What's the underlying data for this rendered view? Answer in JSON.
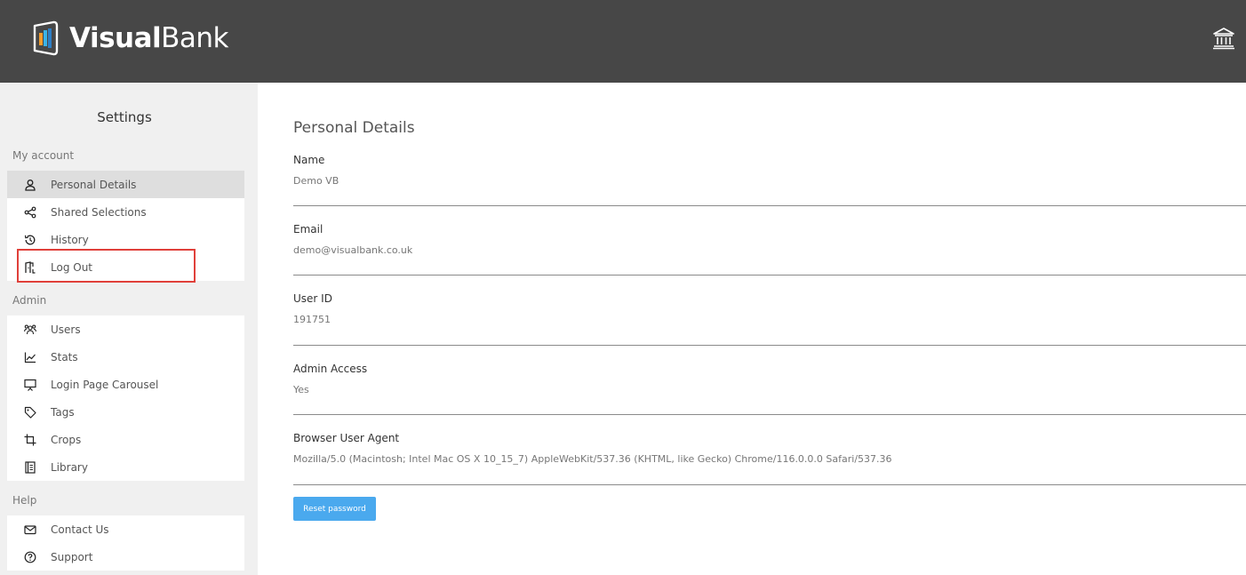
{
  "header": {
    "logo_bold": "Visual",
    "logo_light": "Bank",
    "bank_icon": "bank-icon"
  },
  "sidebar": {
    "title": "Settings",
    "sections": [
      {
        "label": "My account",
        "items": [
          {
            "label": "Personal Details",
            "icon": "user-icon",
            "active": true
          },
          {
            "label": "Shared Selections",
            "icon": "share-icon"
          },
          {
            "label": "History",
            "icon": "history-icon"
          },
          {
            "label": "Log Out",
            "icon": "logout-icon"
          }
        ]
      },
      {
        "label": "Admin",
        "items": [
          {
            "label": "Users",
            "icon": "users-icon"
          },
          {
            "label": "Stats",
            "icon": "chart-icon"
          },
          {
            "label": "Login Page Carousel",
            "icon": "presentation-icon"
          },
          {
            "label": "Tags",
            "icon": "tag-icon"
          },
          {
            "label": "Crops",
            "icon": "crop-icon"
          },
          {
            "label": "Library",
            "icon": "book-icon"
          }
        ]
      },
      {
        "label": "Help",
        "items": [
          {
            "label": "Contact Us",
            "icon": "mail-icon"
          },
          {
            "label": "Support",
            "icon": "help-circle-icon"
          }
        ]
      }
    ]
  },
  "main": {
    "title": "Personal Details",
    "fields": [
      {
        "label": "Name",
        "value": "Demo VB"
      },
      {
        "label": "Email",
        "value": "demo@visualbank.co.uk"
      },
      {
        "label": "User ID",
        "value": "191751"
      },
      {
        "label": "Admin Access",
        "value": "Yes"
      },
      {
        "label": "Browser User Agent",
        "value": "Mozilla/5.0 (Macintosh; Intel Mac OS X 10_15_7) AppleWebKit/537.36 (KHTML, like Gecko) Chrome/116.0.0.0 Safari/537.36"
      }
    ],
    "reset_button": "Reset password"
  },
  "colors": {
    "header_bg": "#474747",
    "sidebar_bg": "#f0f0f0",
    "active_item_bg": "#dedede",
    "button_blue": "#4aa9ee",
    "highlight_red": "#e0403a"
  }
}
